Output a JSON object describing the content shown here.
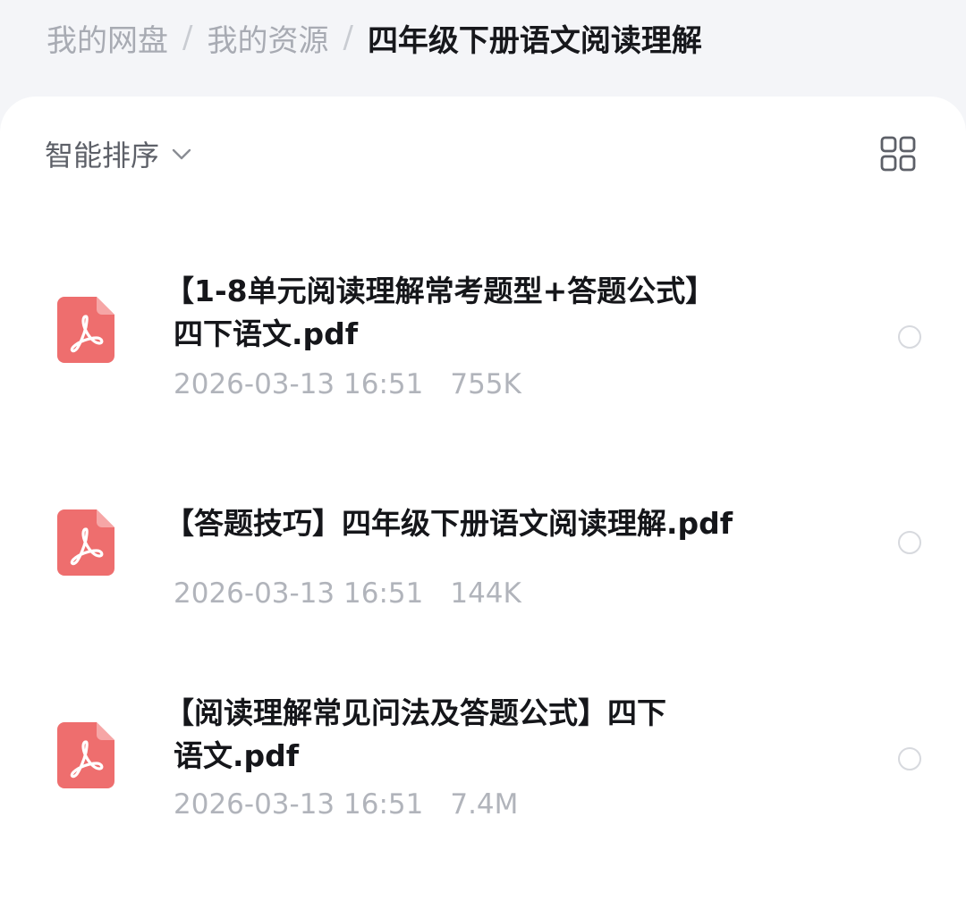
{
  "breadcrumb": {
    "items": [
      "我的网盘",
      "我的资源",
      "四年级下册语文阅读理解"
    ],
    "separator": "/"
  },
  "toolbar": {
    "sort_label": "智能排序",
    "sort_icon": "chevron-down-icon",
    "view_toggle_icon": "grid-view-icon"
  },
  "files": [
    {
      "name_line1": "【1-8单元阅读理解常考题型+答题公式】",
      "name_line2": "四下语文.pdf",
      "date": "2026-03-13 16:51",
      "size": "755K",
      "icon": "pdf-icon"
    },
    {
      "name_line1": "【答题技巧】四年级下册语文阅读理解.pdf",
      "name_line2": "",
      "date": "2026-03-13 16:51",
      "size": "144K",
      "icon": "pdf-icon"
    },
    {
      "name_line1": "【阅读理解常见问法及答题公式】四下",
      "name_line2": "语文.pdf",
      "date": "2026-03-13 16:51",
      "size": "7.4M",
      "icon": "pdf-icon"
    }
  ],
  "colors": {
    "pdf_icon": "#ee6e6e",
    "background": "#f4f5f8",
    "card": "#ffffff",
    "title_text": "#15161a",
    "meta_text": "#b1b4bb"
  }
}
